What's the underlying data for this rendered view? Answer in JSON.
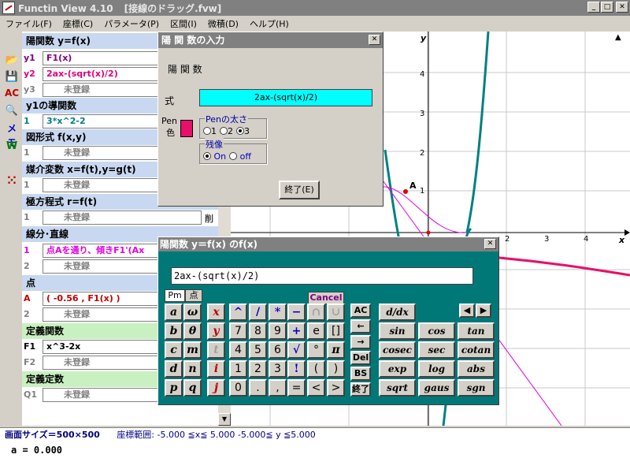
{
  "window": {
    "title_app": "Functin View 4.10",
    "title_file": "[接線のドラッグ.fvw]",
    "min": "_",
    "max": "□",
    "close": "✕"
  },
  "menu": [
    "ファイル(F)",
    "座標(C)",
    "パラメータ(P)",
    "区間(I)",
    "微積(D)",
    "ヘルプ(H)"
  ],
  "toolbar": {
    "ac": "AC",
    "memo": "メモ",
    "w": "W"
  },
  "panel": {
    "explicit_header": "陽関数 y=f(x)",
    "y1_label": "y1",
    "y1_value": "F1(x)",
    "y2_label": "y2",
    "y2_value": "2ax-(sqrt(x)/2)",
    "y3_label": "y3",
    "y3_value": "未登録",
    "deriv_header": "y1の導関数",
    "deriv1_label": "1",
    "deriv1_value": "3*x^2-2",
    "implicit_header": "図形式 f(x,y)",
    "implicit1_label": "1",
    "implicit1_value": "未登録",
    "param_header": "媒介変数 x=f(t),y=g(t)",
    "param1_label": "1",
    "param1_value": "未登録",
    "polar_header": "極方程式 r=f(t)",
    "polar1_label": "1",
    "polar1_value": "未登録",
    "polar1_del": "削",
    "line_header": "線分･直線",
    "line1_label": "1",
    "line1_value": "点Aを通り、傾きF1'(Ax",
    "line2_label": "2",
    "line2_value": "未登録",
    "point_header": "点",
    "pointA_label": "A",
    "pointA_value": "( -0.56 , F1(x) )",
    "point2_label": "2",
    "point2_value": "未登録",
    "deffunc_header": "定義関数",
    "F1_label": "F1",
    "F1_value": "x^3-2x",
    "F2_label": "F2",
    "F2_value": "未登録",
    "defconst_header": "定義定数",
    "Q1_label": "Q1",
    "Q1_value": "未登録"
  },
  "graph": {
    "axis_y": "y",
    "axis_x": "x",
    "point_label": "A",
    "yticks": [
      "4",
      "3",
      "2",
      "1"
    ],
    "xticks": [
      "1",
      "2",
      "3",
      "4"
    ]
  },
  "status": {
    "size": "画面サイズ＝500×500",
    "range": "座標範囲:  -5.000 ≦x≦ 5.000  -5.000≦ y ≦5.000",
    "param": "a = 0.000"
  },
  "dialog1": {
    "title": "陽 関 数の入力",
    "heading": "陽 関 数",
    "expr_label": "式",
    "expr_value": "2ax-(sqrt(x)/2)",
    "pen_label": "Pen",
    "color_label": "色",
    "width_legend": "Penの太さ",
    "width_opts": [
      "1",
      "2",
      "3"
    ],
    "afterimage_legend": "残像",
    "after_on": "On",
    "after_off": "off",
    "ok": "終了(E)"
  },
  "dialog2": {
    "title": "陽関数  y＝f(x) のf(x)",
    "input_value": "2ax-(sqrt(x)/2)",
    "tab_pm": "Pm",
    "tab_point": "点",
    "cancel": "Cancel",
    "greek": [
      "a",
      "ω",
      "b",
      "θ",
      "c",
      "m",
      "d",
      "n",
      "p",
      "q"
    ],
    "vars": [
      "x",
      "y",
      "t",
      "i",
      "j"
    ],
    "ops_row1": [
      "^",
      "/",
      "*",
      "−",
      "∩",
      "∪"
    ],
    "ops_row2": [
      "7",
      "8",
      "9",
      "+",
      "e",
      "[]"
    ],
    "ops_row3": [
      "4",
      "5",
      "6",
      "√",
      "°",
      "π"
    ],
    "ops_row4": [
      "1",
      "2",
      "3",
      "!",
      "(",
      ")"
    ],
    "ops_row5": [
      "0",
      ".",
      ",",
      "=",
      "<",
      ">"
    ],
    "edit": [
      "AC",
      "←",
      "→",
      "Del",
      "BS",
      "終了"
    ],
    "deriv": "d/dx",
    "funcs": [
      "sin",
      "cos",
      "tan",
      "cosec",
      "sec",
      "cotan",
      "exp",
      "log",
      "abs",
      "sqrt",
      "gaus",
      "sgn"
    ]
  }
}
